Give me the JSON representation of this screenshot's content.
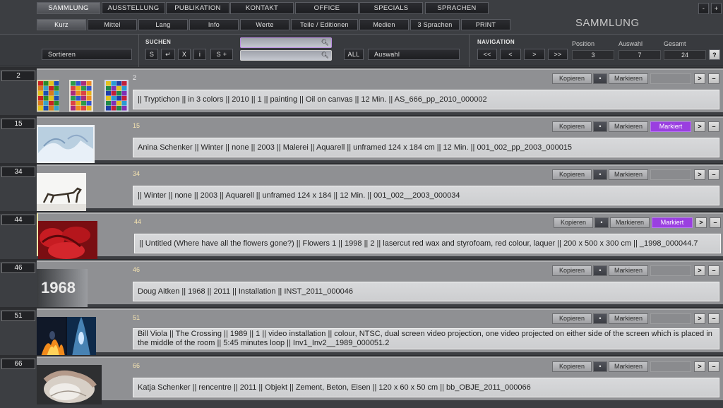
{
  "main_nav": [
    "SAMMLUNG",
    "AUSSTELLUNG",
    "PUBLIKATION",
    "KONTAKT",
    "OFFICE",
    "SPECIALS",
    "SPRACHEN"
  ],
  "window_buttons": [
    "-",
    "+"
  ],
  "sub_nav": [
    "Kurz",
    "Mittel",
    "Lang",
    "Info",
    "Werte",
    "Teile / Editionen",
    "Medien",
    "3 Sprachen",
    "PRINT"
  ],
  "section_title": "SAMMLUNG",
  "controls": {
    "sort_label": "Sortieren",
    "search_label": "SUCHEN",
    "search_buttons": [
      "S",
      "↵",
      "X",
      "i",
      "S +"
    ],
    "search_value_1": "",
    "search_value_2": "",
    "all_label": "ALL",
    "selection_label": "Auswahl",
    "navigation_label": "NAVIGATION",
    "nav_buttons": [
      "<<",
      "<",
      ">",
      ">>"
    ],
    "position_label": "Position",
    "position_value": "3",
    "auswahl_label": "Auswahl",
    "auswahl_value": "7",
    "gesamt_label": "Gesamt",
    "gesamt_value": "24",
    "help_label": "?"
  },
  "row_buttons": {
    "copy": "Kopieren",
    "dot": "•",
    "mark": "Markieren",
    "marked": "Markiert",
    "next": ">",
    "minus": "–"
  },
  "records": [
    {
      "num": "2",
      "num_color": "white",
      "marked": false,
      "desc": "|| Tryptichon || in 3 colors || 2010 || 1 || painting || Oil on canvas || 12 Min. || AS_666_pp_2010_000002"
    },
    {
      "num": "15",
      "num_color": "orange",
      "marked": true,
      "desc": "Anina Schenker || Winter || none || 2003 || Malerei || Aquarell || unframed 124 x 184 cm || 12 Min. || 001_002_pp_2003_000015"
    },
    {
      "num": "34",
      "num_color": "orange",
      "marked": false,
      "desc": "|| Winter || none || 2003 || Aquarell || unframed 124 x 184 || 12 Min. || 001_002__2003_000034"
    },
    {
      "num": "44",
      "num_color": "orange",
      "marked": true,
      "desc": " || Untitled (Where have all the flowers gone?) || Flowers 1 || 1998 || 2 || lasercut red wax and styrofoam, red colour, laquer || 200 x 500 x 300 cm || _1998_000044.7"
    },
    {
      "num": "46",
      "num_color": "orange",
      "marked": false,
      "desc": "Doug Aitken || 1968 || 2011 || Installation || INST_2011_000046"
    },
    {
      "num": "51",
      "num_color": "orange",
      "marked": false,
      "desc": "Bill Viola || The Crossing || 1989 || 1 || video installation || colour, NTSC, dual screen video projection, one video projected on either side of the screen which is placed in the middle of the room || 5:45 minutes loop || Inv1_Inv2__1989_000051.2"
    },
    {
      "num": "66",
      "num_color": "orange",
      "marked": false,
      "desc": "Katja Schenker || rencentre || 2011 || Objekt || Zement, Beton, Eisen || 120 x 60 x 50 cm || bb_OBJE_2011_000066"
    }
  ],
  "thumbnails": [
    "tryptichon-thumb",
    "winter-watercolor-thumb",
    "dog-sculpture-thumb",
    "red-wax-flowers-thumb",
    "1968-text-thumb",
    "crossing-video-thumb",
    "concrete-figure-thumb"
  ]
}
